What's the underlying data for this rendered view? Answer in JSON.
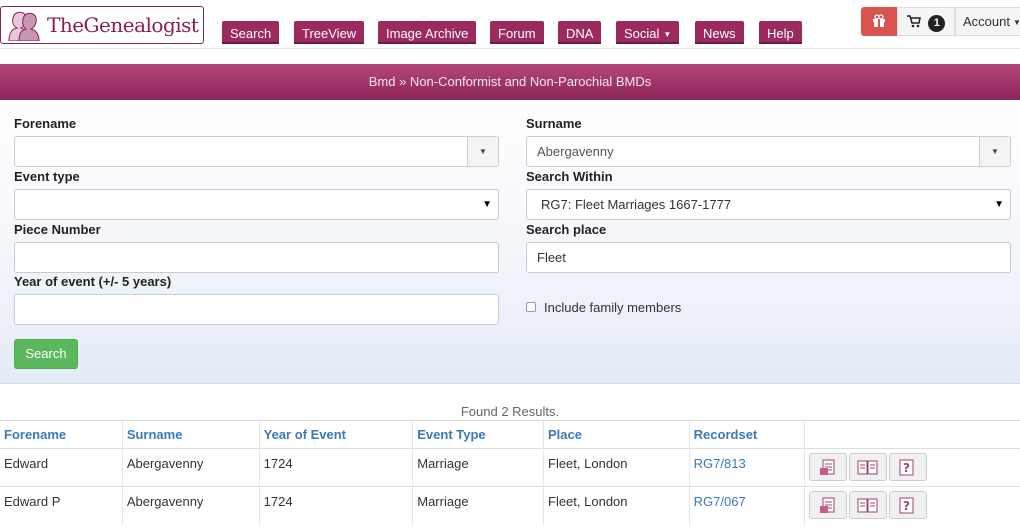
{
  "header": {
    "logo_text": "TheGenealogist",
    "nav": [
      "Search",
      "TreeView",
      "Image Archive",
      "Forum",
      "DNA",
      "Social",
      "News",
      "Help"
    ],
    "cart_count": "1",
    "account_label": "Account"
  },
  "breadcrumb": "Bmd » Non-Conformist and Non-Parochial BMDs",
  "form": {
    "forename_label": "Forename",
    "forename_value": "",
    "surname_label": "Surname",
    "surname_value": "Abergavenny",
    "event_type_label": "Event type",
    "event_type_value": "",
    "search_within_label": "Search Within",
    "search_within_value": "RG7: Fleet Marriages 1667-1777",
    "piece_number_label": "Piece Number",
    "piece_number_value": "",
    "search_place_label": "Search place",
    "search_place_value": "Fleet",
    "year_label": "Year of event (+/- 5 years)",
    "year_value": "",
    "include_family_label": "Include family members",
    "search_button": "Search"
  },
  "results": {
    "summary": "Found 2 Results.",
    "columns": [
      "Forename",
      "Surname",
      "Year of Event",
      "Event Type",
      "Place",
      "Recordset"
    ],
    "rows": [
      {
        "forename": "Edward",
        "surname": "Abergavenny",
        "year": "1724",
        "event": "Marriage",
        "place": "Fleet, London",
        "recordset": "RG7/813"
      },
      {
        "forename": "Edward P",
        "surname": "Abergavenny",
        "year": "1724",
        "event": "Marriage",
        "place": "Fleet, London",
        "recordset": "RG7/067"
      }
    ]
  },
  "colors": {
    "brand": "#9b2a5f",
    "link": "#3a7ab8",
    "search_button": "#5cb85c",
    "gift": "#d9534f"
  }
}
